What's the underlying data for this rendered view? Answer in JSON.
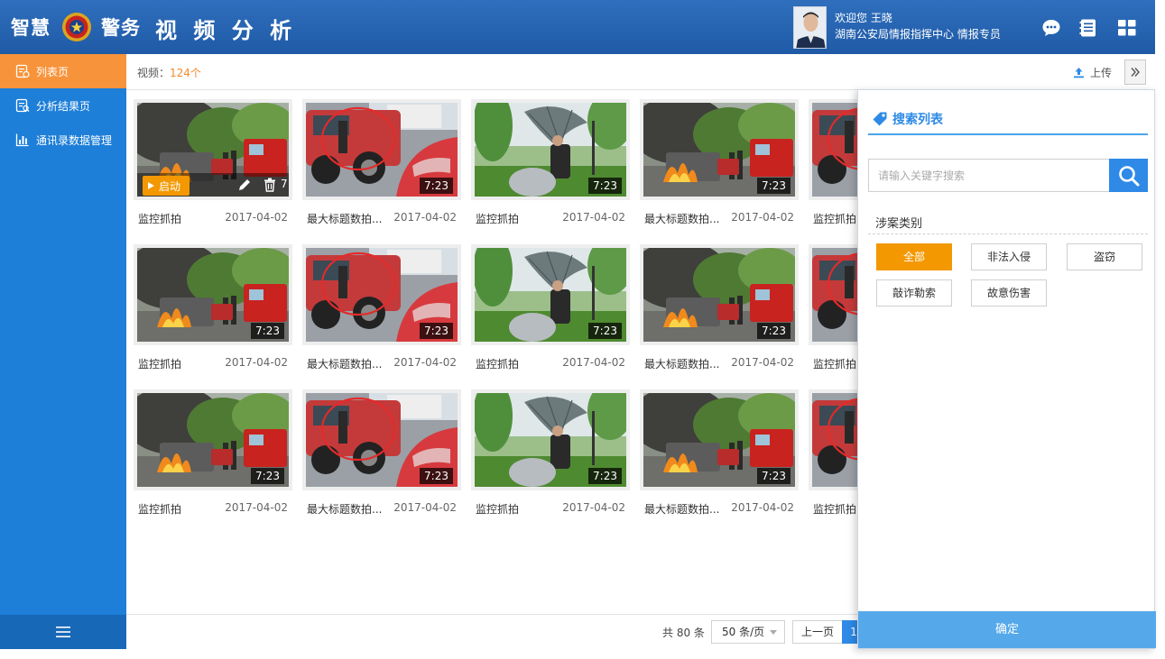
{
  "header": {
    "brand_left": "智慧",
    "brand_right": "警务",
    "app_title": "视 频 分 析",
    "welcome": "欢迎您 王晓",
    "org": "湖南公安局情报指挥中心 情报专员"
  },
  "sidebar": {
    "items": [
      {
        "label": "列表页",
        "icon": "list-page-icon",
        "active": true
      },
      {
        "label": "分析结果页",
        "icon": "analysis-result-icon",
        "active": false
      },
      {
        "label": "通讯录数据管理",
        "icon": "bar-chart-icon",
        "active": false
      }
    ],
    "menu_icon": "hamburger-menu-icon"
  },
  "topbar": {
    "count_label": "视频：",
    "count_value": "124个",
    "upload_label": "上传"
  },
  "cards": [
    {
      "title": "监控抓拍",
      "date": "2017-04-02",
      "duration": "7:23",
      "scene": "fire"
    },
    {
      "title": "最大标题数拍...",
      "date": "2017-04-02",
      "duration": "7:23",
      "scene": "car"
    },
    {
      "title": "监控抓拍",
      "date": "2017-04-02",
      "duration": "7:23",
      "scene": "umbrella"
    },
    {
      "title": "最大标题数拍...",
      "date": "2017-04-02",
      "duration": "7:23",
      "scene": "fire"
    },
    {
      "title": "监控抓拍",
      "date": "",
      "duration": "",
      "scene": "car"
    },
    {
      "title": "监控抓拍",
      "date": "2017-04-02",
      "duration": "7:23",
      "scene": "fire"
    },
    {
      "title": "最大标题数拍...",
      "date": "2017-04-02",
      "duration": "7:23",
      "scene": "car"
    },
    {
      "title": "监控抓拍",
      "date": "2017-04-02",
      "duration": "7:23",
      "scene": "umbrella"
    },
    {
      "title": "最大标题数拍...",
      "date": "2017-04-02",
      "duration": "7:23",
      "scene": "fire"
    },
    {
      "title": "监控抓拍",
      "date": "",
      "duration": "",
      "scene": "car"
    },
    {
      "title": "监控抓拍",
      "date": "2017-04-02",
      "duration": "7:23",
      "scene": "fire"
    },
    {
      "title": "最大标题数拍...",
      "date": "2017-04-02",
      "duration": "7:23",
      "scene": "car"
    },
    {
      "title": "监控抓拍",
      "date": "2017-04-02",
      "duration": "7:23",
      "scene": "umbrella"
    },
    {
      "title": "最大标题数拍...",
      "date": "2017-04-02",
      "duration": "7:23",
      "scene": "fire"
    },
    {
      "title": "监控抓拍",
      "date": "",
      "duration": "",
      "scene": "car"
    }
  ],
  "first_card_overlay": {
    "play_label": "启动",
    "duration_partial": "7"
  },
  "pager": {
    "total": "共 80 条",
    "page_size": "50 条/页",
    "prev": "上一页",
    "current": "1"
  },
  "search_panel": {
    "title": "搜索列表",
    "placeholder": "请输入关键字搜索",
    "category_label": "涉案类别",
    "tags": [
      {
        "label": "全部",
        "active": true
      },
      {
        "label": "非法入侵",
        "active": false
      },
      {
        "label": "盗窃",
        "active": false
      },
      {
        "label": "敲诈勒索",
        "active": false
      },
      {
        "label": "故意伤害",
        "active": false
      }
    ],
    "confirm": "确定"
  },
  "colors": {
    "header": "#1f5aa6",
    "sidebar": "#1d7fd8",
    "active_orange": "#f39800",
    "accent_blue": "#2e8ae6"
  }
}
